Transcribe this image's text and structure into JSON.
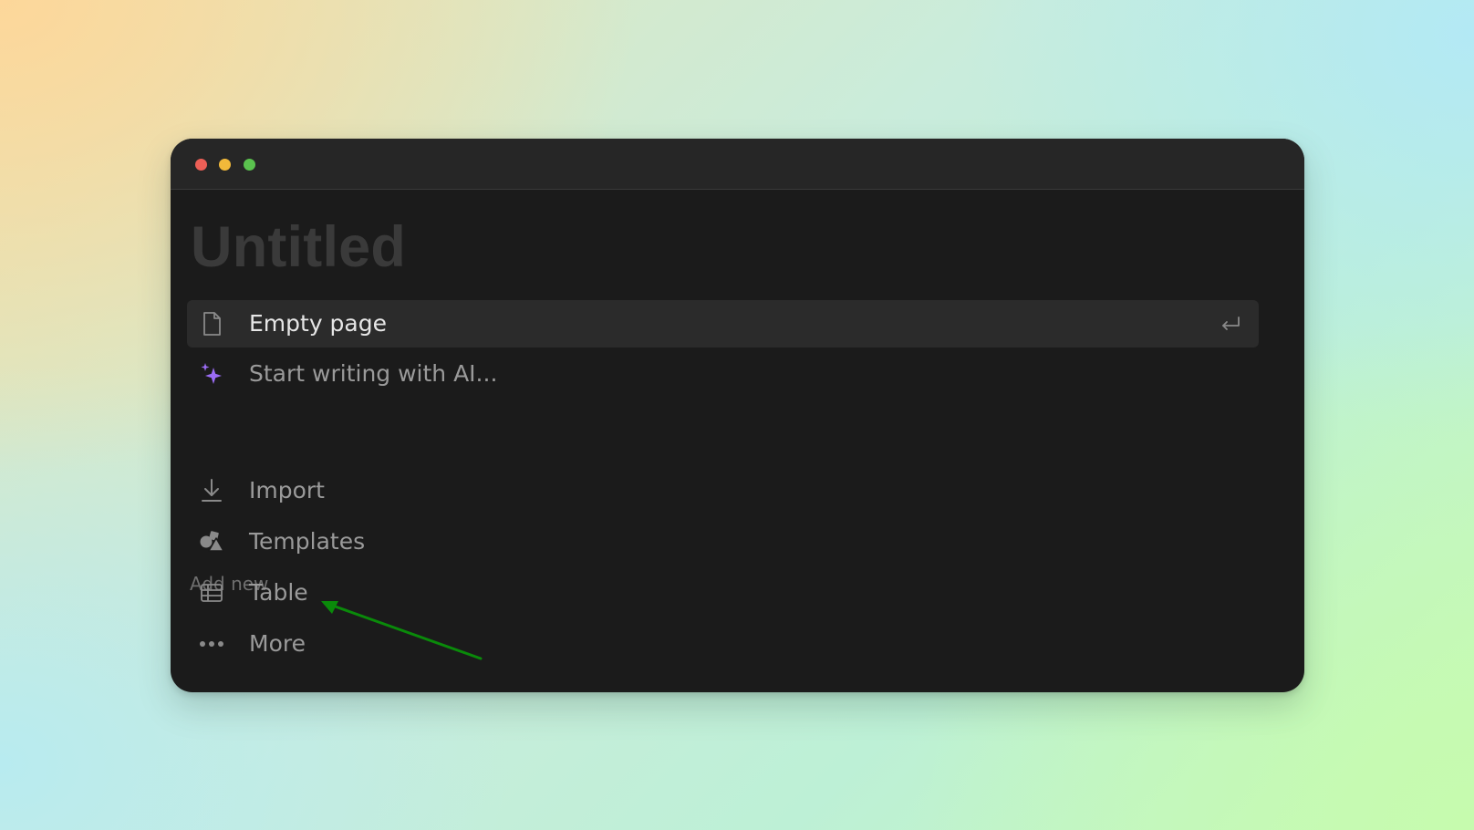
{
  "window": {
    "controls": {
      "close_color": "#ec5f56",
      "minimize_color": "#f2b93a",
      "maximize_color": "#5ac24e"
    }
  },
  "page": {
    "title": "Untitled"
  },
  "options": [
    {
      "label": "Empty page",
      "icon": "document-icon",
      "selected": true,
      "shortcut_icon": "enter-key-icon"
    },
    {
      "label": "Start writing with AI...",
      "icon": "ai-sparkle-icon",
      "icon_color": "#9b6cf5"
    }
  ],
  "add_new": {
    "heading": "Add new",
    "items": [
      {
        "label": "Import",
        "icon": "import-arrow-icon"
      },
      {
        "label": "Templates",
        "icon": "shapes-icon"
      },
      {
        "label": "Table",
        "icon": "table-icon"
      },
      {
        "label": "More",
        "icon": "more-dots-icon"
      }
    ]
  },
  "annotation": {
    "type": "arrow",
    "color": "#0a8a0a",
    "points_to": "Table"
  }
}
